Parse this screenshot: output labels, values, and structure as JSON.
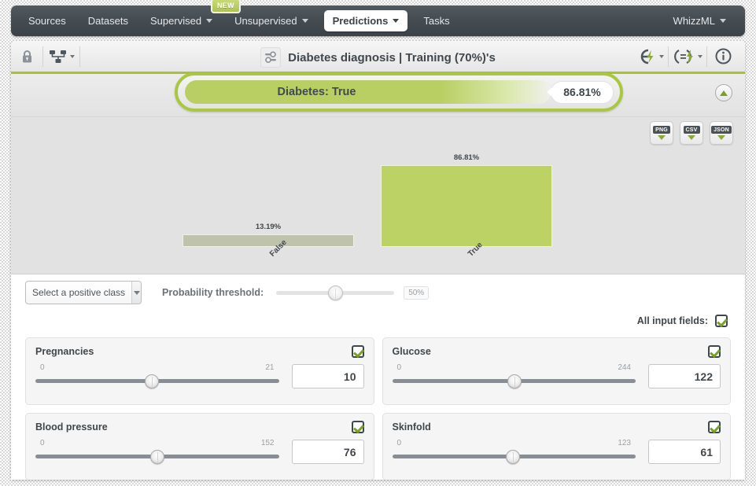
{
  "topnav": {
    "items": [
      {
        "label": "Sources",
        "has_caret": false,
        "active": false
      },
      {
        "label": "Datasets",
        "has_caret": false,
        "active": false
      },
      {
        "label": "Supervised",
        "has_caret": true,
        "active": false
      },
      {
        "label": "Unsupervised",
        "has_caret": true,
        "active": false
      },
      {
        "label": "Predictions",
        "has_caret": true,
        "active": true
      },
      {
        "label": "Tasks",
        "has_caret": false,
        "active": false
      }
    ],
    "new_badge": "NEW",
    "right_item": {
      "label": "WhizzML",
      "has_caret": true
    }
  },
  "titlebar": {
    "title": "Diabetes diagnosis | Training (70%)'s",
    "left_icons": [
      "lock-icon",
      "model-tree-icon"
    ],
    "right_icons": [
      "lightning-bolt-icon",
      "batch-prediction-icon",
      "info-icon"
    ],
    "title_icon": "prediction-sliders-icon"
  },
  "prediction": {
    "label": "Diabetes: True",
    "percent": "86.81%",
    "accent_color": "#a9c83f",
    "collapse_icon": "collapse-up-icon"
  },
  "downloads": [
    {
      "label": "PNG",
      "name": "download-png-button"
    },
    {
      "label": "CSV",
      "name": "download-csv-button"
    },
    {
      "label": "JSON",
      "name": "download-json-button"
    }
  ],
  "chart_data": {
    "type": "bar",
    "title": "",
    "xlabel": "",
    "ylabel": "",
    "categories": [
      "False",
      "True"
    ],
    "values": [
      13.19,
      86.81
    ],
    "value_labels": [
      "13.19%",
      "86.81%"
    ],
    "ylim": [
      0,
      100
    ],
    "grid": false,
    "legend": false,
    "colors": [
      "#bfc3ab",
      "#bcd264"
    ],
    "background": "#e2e2e2"
  },
  "controls": {
    "positive_class_placeholder": "Select a positive class",
    "threshold_label": "Probability threshold:",
    "threshold_value": "50%",
    "threshold_percent": 50
  },
  "all_input_fields": {
    "label": "All input fields:",
    "checked": true
  },
  "fields": [
    {
      "name": "Pregnancies",
      "min": "0",
      "max": "21",
      "value": "10",
      "fraction": 0.476,
      "checked": true
    },
    {
      "name": "Glucose",
      "min": "0",
      "max": "244",
      "value": "122",
      "fraction": 0.5,
      "checked": true
    },
    {
      "name": "Blood pressure",
      "min": "0",
      "max": "152",
      "value": "76",
      "fraction": 0.5,
      "checked": true
    },
    {
      "name": "Skinfold",
      "min": "0",
      "max": "123",
      "value": "61",
      "fraction": 0.496,
      "checked": true
    }
  ]
}
